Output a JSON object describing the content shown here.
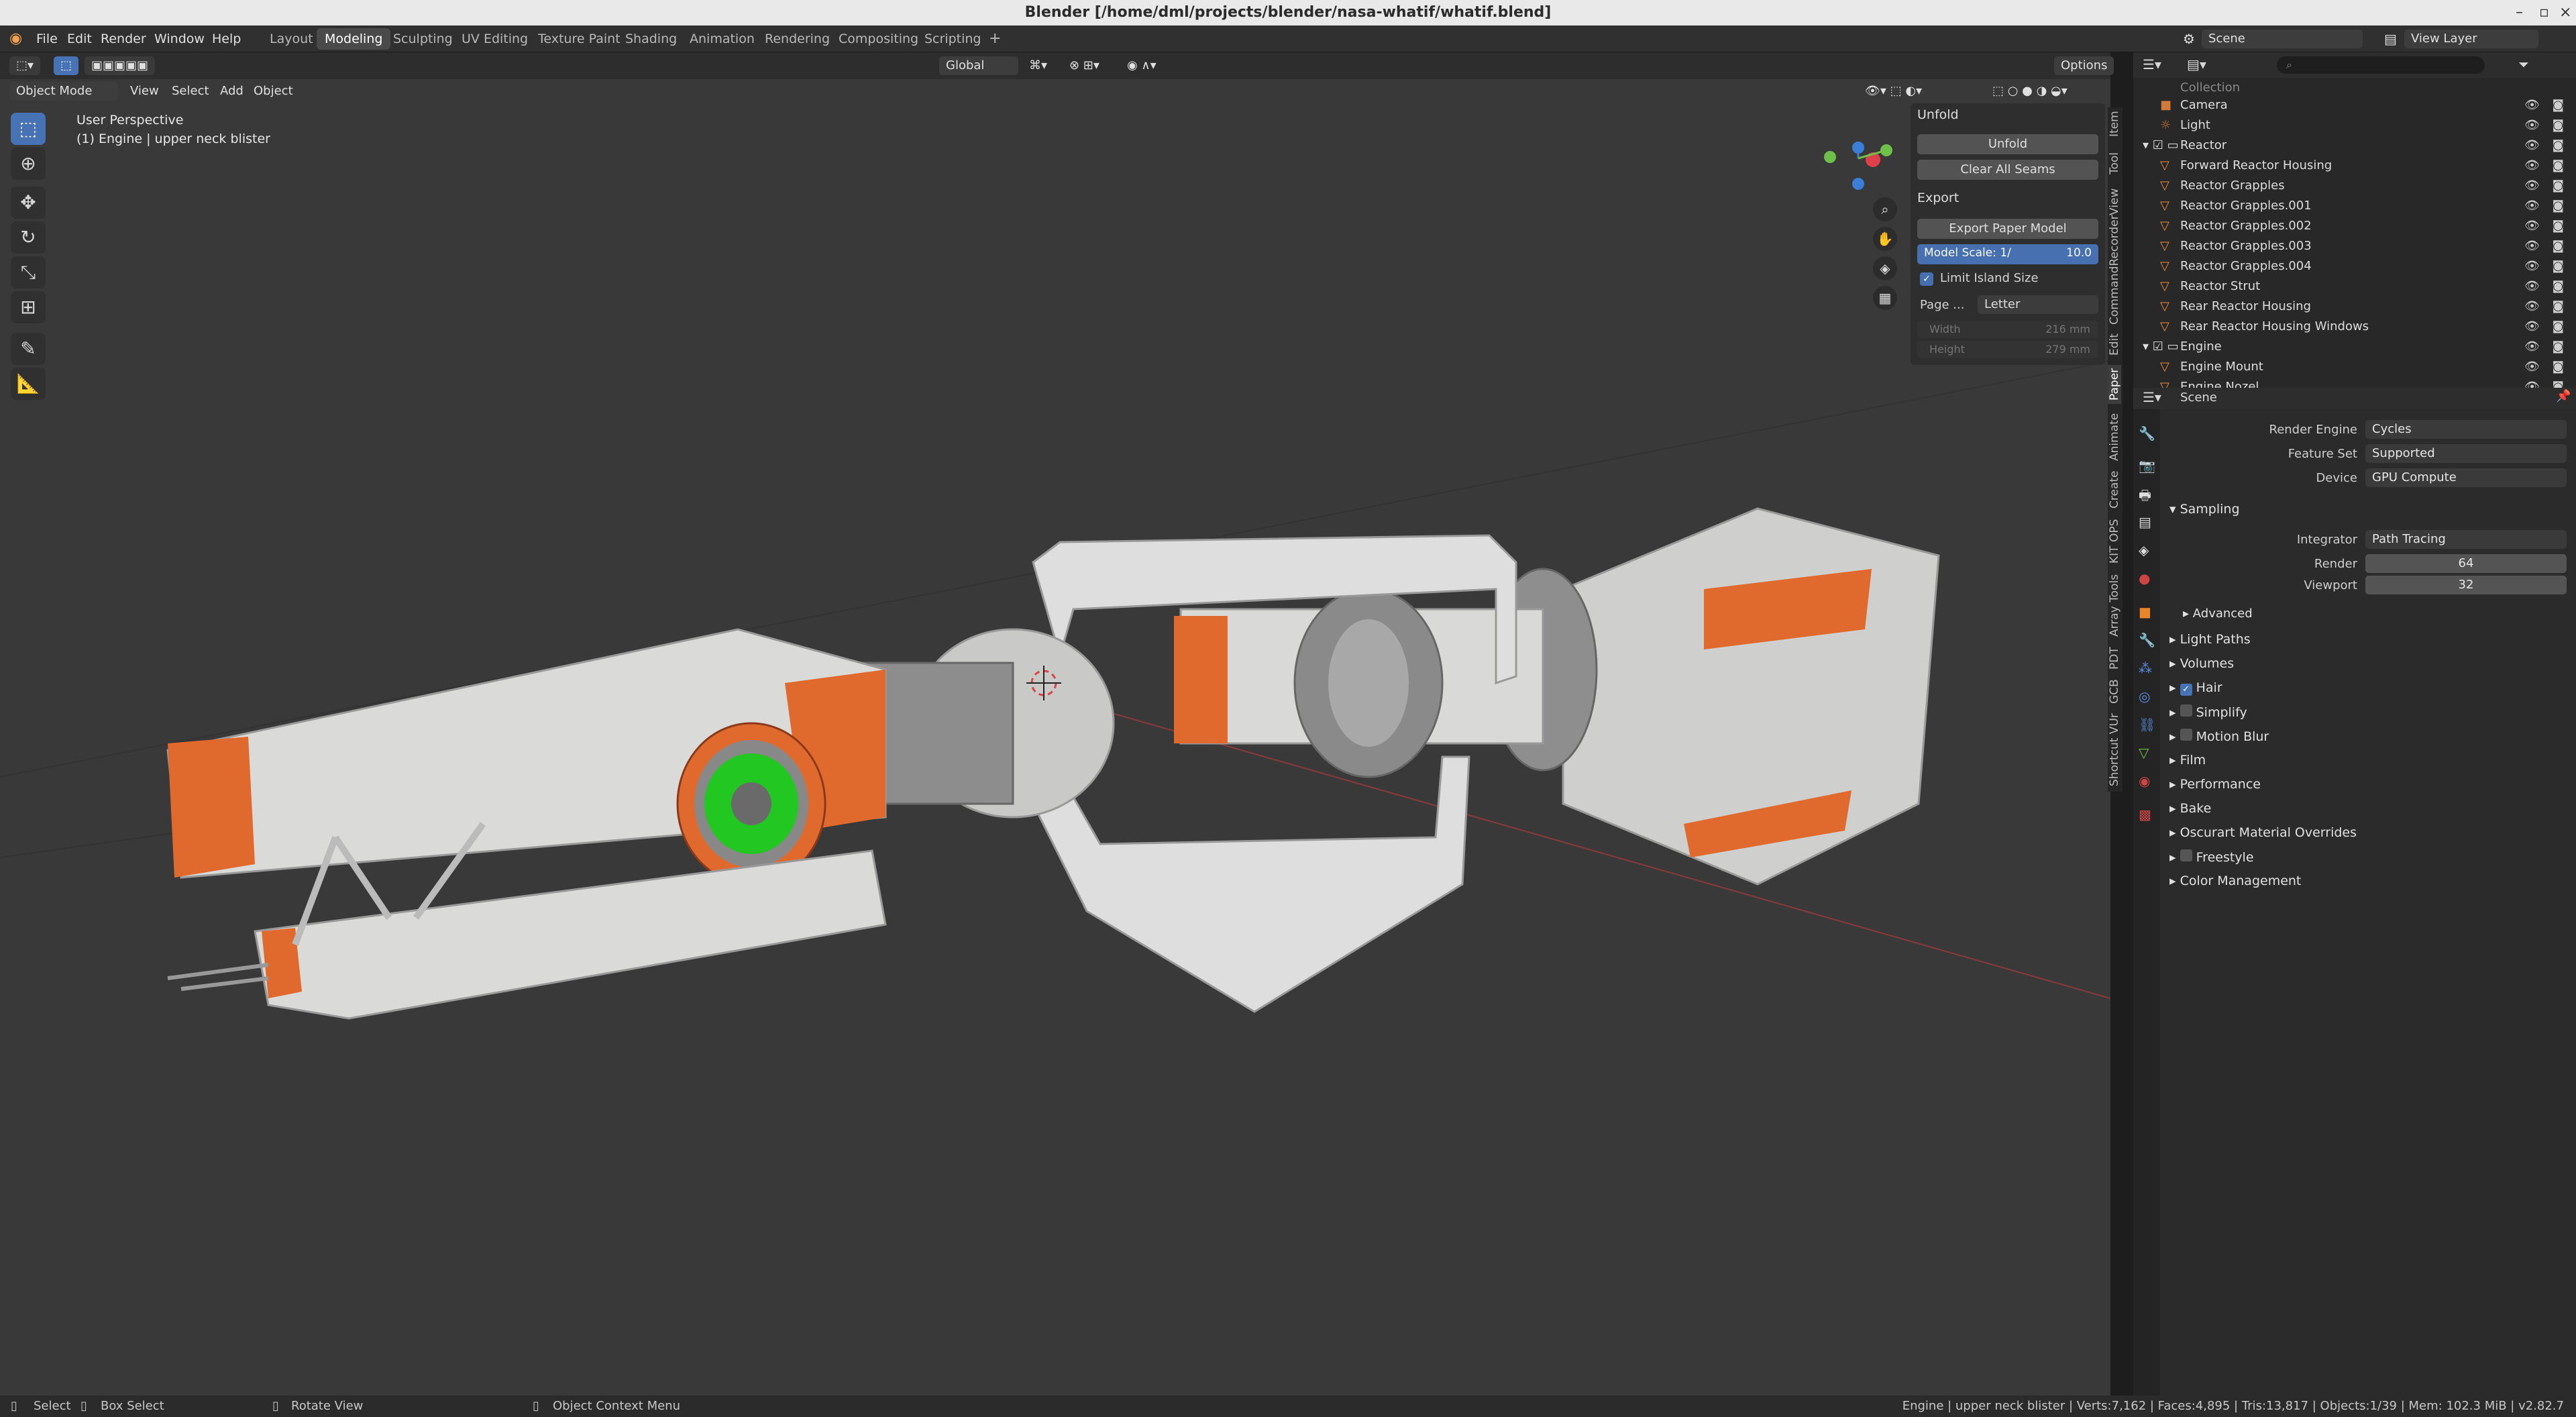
{
  "window": {
    "title": "Blender [/home/dml/projects/blender/nasa-whatif/whatif.blend]"
  },
  "menu": [
    "File",
    "Edit",
    "Render",
    "Window",
    "Help"
  ],
  "workspaces": [
    "Layout",
    "Modeling",
    "Sculpting",
    "UV Editing",
    "Texture Paint",
    "Shading",
    "Animation",
    "Rendering",
    "Compositing",
    "Scripting"
  ],
  "active_workspace": "Modeling",
  "scene": {
    "name": "Scene",
    "view_layer": "View Layer"
  },
  "toolbar": {
    "transform": "Global",
    "options": "Options"
  },
  "viewport_header": {
    "mode": "Object Mode",
    "menus": [
      "View",
      "Select",
      "Add",
      "Object"
    ]
  },
  "viewport": {
    "perspective": "User Perspective",
    "active": "(1) Engine | upper neck blister"
  },
  "npanel": {
    "unfold_title": "Unfold",
    "unfold_btn": "Unfold",
    "clear_btn": "Clear All Seams",
    "export_title": "Export",
    "export_btn": "Export Paper Model",
    "scale_label": "Model Scale: 1/",
    "scale_value": "10.0",
    "limit_label": "Limit Island Size",
    "page_label": "Page ...",
    "page_value": "Letter",
    "width_label": "Width",
    "width_value": "216 mm",
    "height_label": "Height",
    "height_value": "279 mm"
  },
  "side_tabs": [
    "Item",
    "Tool",
    "View",
    "CommandRecorder",
    "Edit",
    "Paper",
    "Animate",
    "Create",
    "KIT OPS",
    "Array Tools",
    "PDT",
    "GCB",
    "Shortcut VUr"
  ],
  "outliner": [
    {
      "name": "Collection",
      "indent": 1
    },
    {
      "name": "Camera",
      "indent": 1
    },
    {
      "name": "Light",
      "indent": 1
    },
    {
      "name": "Reactor",
      "indent": 0
    },
    {
      "name": "Forward Reactor Housing",
      "indent": 1
    },
    {
      "name": "Reactor Grapples",
      "indent": 1
    },
    {
      "name": "Reactor Grapples.001",
      "indent": 1
    },
    {
      "name": "Reactor Grapples.002",
      "indent": 1
    },
    {
      "name": "Reactor Grapples.003",
      "indent": 1
    },
    {
      "name": "Reactor Grapples.004",
      "indent": 1
    },
    {
      "name": "Reactor Strut",
      "indent": 1
    },
    {
      "name": "Rear Reactor Housing",
      "indent": 1
    },
    {
      "name": "Rear Reactor Housing Windows",
      "indent": 1
    },
    {
      "name": "Engine",
      "indent": 0
    },
    {
      "name": "Engine Mount",
      "indent": 1
    },
    {
      "name": "Engine Nozel",
      "indent": 1
    }
  ],
  "properties": {
    "context": "Scene",
    "render_engine_label": "Render Engine",
    "render_engine": "Cycles",
    "feature_set_label": "Feature Set",
    "feature_set": "Supported",
    "device_label": "Device",
    "device": "GPU Compute",
    "sampling": "Sampling",
    "integrator_label": "Integrator",
    "integrator": "Path Tracing",
    "render_label": "Render",
    "render_samples": "64",
    "viewport_label": "Viewport",
    "viewport_samples": "32",
    "advanced": "Advanced",
    "sections": [
      "Light Paths",
      "Volumes",
      "Hair",
      "Simplify",
      "Motion Blur",
      "Film",
      "Performance",
      "Bake",
      "Oscurart Material Overrides",
      "Freestyle",
      "Color Management"
    ]
  },
  "statusbar": {
    "select": "Select",
    "box_select": "Box Select",
    "rotate": "Rotate View",
    "context_menu": "Object Context Menu",
    "stats": "Engine | upper neck blister | Verts:7,162 | Faces:4,895 | Tris:13,817 | Objects:1/39 | Mem: 102.3 MiB | v2.82.7"
  },
  "colors": {
    "accent": "#4772b3",
    "orange": "#e06a2d",
    "green": "#22c722",
    "model": "#d9d9d7"
  }
}
